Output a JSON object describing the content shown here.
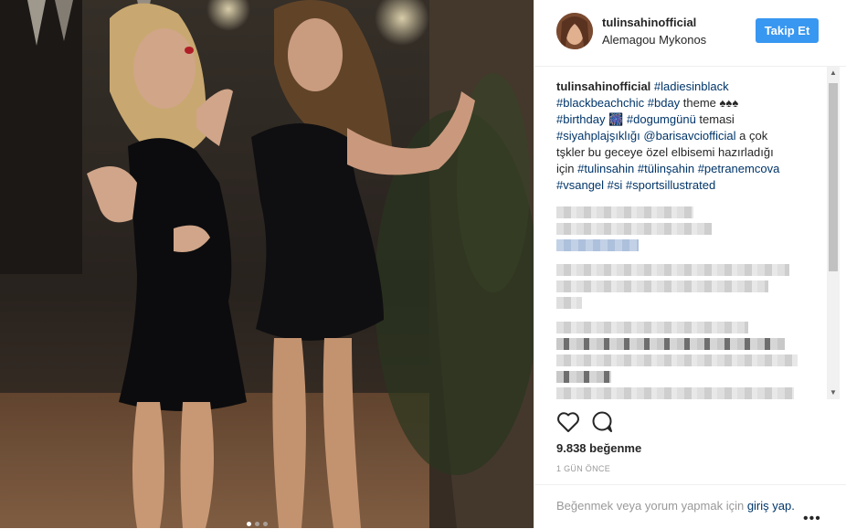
{
  "post": {
    "username": "tulinsahinofficial",
    "location": "Alemagou Mykonos",
    "follow_label": "Takip Et",
    "caption": {
      "username": "tulinsahinofficial",
      "segments": [
        {
          "text": "#ladiesinblack",
          "tag": true
        },
        {
          "text": "\n",
          "tag": false
        },
        {
          "text": "#blackbeachchic",
          "tag": true
        },
        {
          "text": " ",
          "tag": false
        },
        {
          "text": "#bday",
          "tag": true
        },
        {
          "text": " theme ♠♠♠\n",
          "tag": false
        },
        {
          "text": "#birthday",
          "tag": true
        },
        {
          "text": " 🎆 ",
          "tag": false
        },
        {
          "text": "#dogumgünü",
          "tag": true
        },
        {
          "text": " temasi\n",
          "tag": false
        },
        {
          "text": "#siyahplajşıklığı",
          "tag": true
        },
        {
          "text": " ",
          "tag": false
        },
        {
          "text": "@barisavciofficial",
          "tag": true
        },
        {
          "text": " a çok\ntşkler bu geceye özel elbisemi hazırladığı\niçin ",
          "tag": false
        },
        {
          "text": "#tulinsahin",
          "tag": true
        },
        {
          "text": " ",
          "tag": false
        },
        {
          "text": "#tülinşahin",
          "tag": true
        },
        {
          "text": " ",
          "tag": false
        },
        {
          "text": "#petranemcova",
          "tag": true
        },
        {
          "text": "\n",
          "tag": false
        },
        {
          "text": "#vsangel",
          "tag": true
        },
        {
          "text": " ",
          "tag": false
        },
        {
          "text": "#si",
          "tag": true
        },
        {
          "text": " ",
          "tag": false
        },
        {
          "text": "#sportsillustrated",
          "tag": true
        }
      ]
    },
    "likes_text": "9.838 beğenme",
    "time_text": "1 GÜN ÖNCE",
    "login_prompt": "Beğenmek veya yorum yapmak için ",
    "login_link": "giriş yap.",
    "more_label": "•••"
  },
  "icons": {
    "like": "heart-icon",
    "comment": "comment-icon",
    "more": "more-options-icon"
  },
  "colors": {
    "accent": "#3897f0",
    "link": "#003569",
    "text": "#262626",
    "muted": "#999999"
  },
  "carousel": {
    "slide_count": 3,
    "active_index": 0
  }
}
